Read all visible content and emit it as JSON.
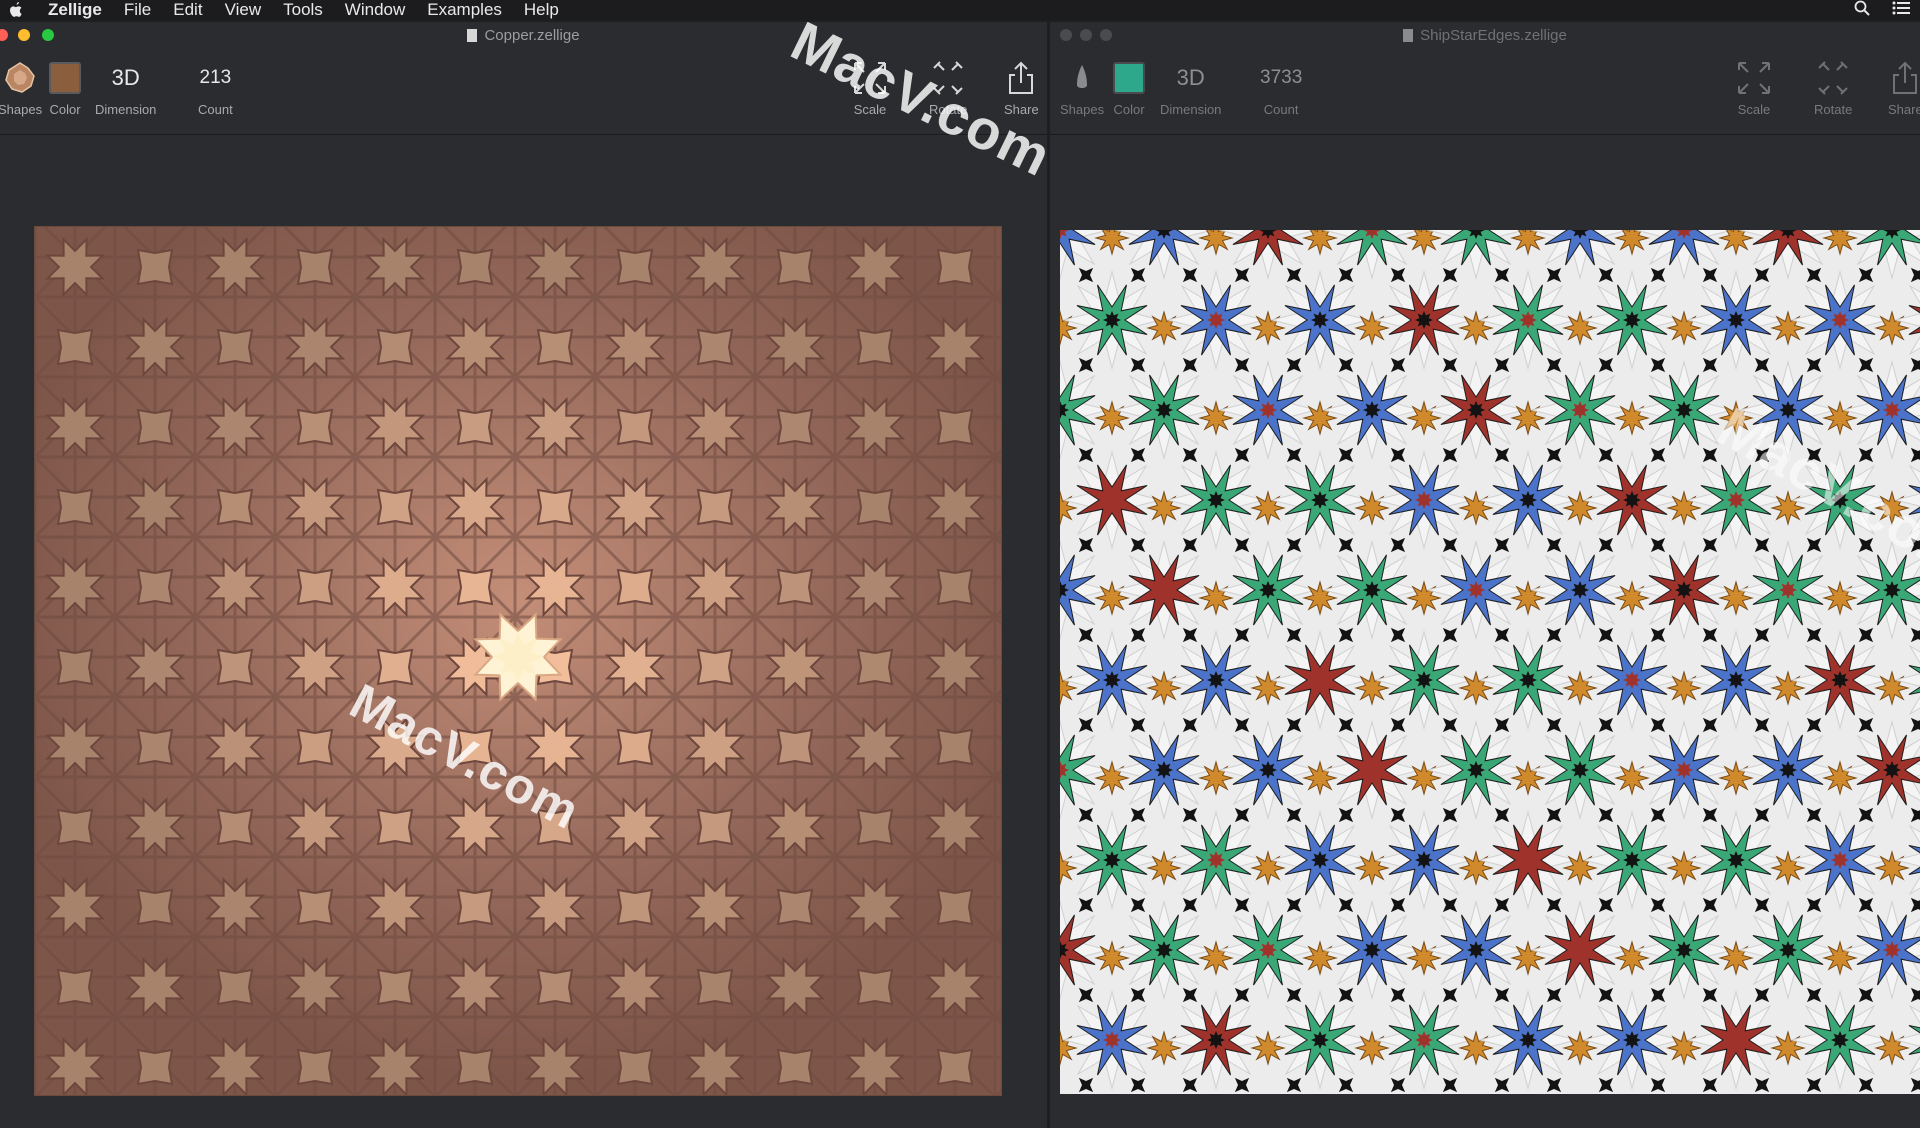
{
  "menubar": {
    "app_name": "Zellige",
    "items": [
      "File",
      "Edit",
      "View",
      "Tools",
      "Window",
      "Examples",
      "Help"
    ]
  },
  "left_window": {
    "title": "Copper.zellige",
    "toolbar": {
      "shapes_label": "Shapes",
      "color_label": "Color",
      "dimension_value": "3D",
      "dimension_label": "Dimension",
      "count_value": "213",
      "count_label": "Count",
      "scale_label": "Scale",
      "rotate_label": "Rotate",
      "share_label": "Share"
    },
    "swatch_color": "#8b5e3e"
  },
  "right_window": {
    "title": "ShipStarEdges.zellige",
    "toolbar": {
      "shapes_label": "Shapes",
      "color_label": "Color",
      "dimension_value": "3D",
      "dimension_label": "Dimension",
      "count_value": "3733",
      "count_label": "Count",
      "scale_label": "Scale",
      "rotate_label": "Rotate",
      "share_label": "Share"
    },
    "swatch_color": "#2ea88a"
  },
  "watermark": "MacV.com",
  "colors": {
    "copper_base": "#8a5f52",
    "copper_highlight": "#f7d9b6",
    "tile_blue": "#4b73c9",
    "tile_green": "#3aa876",
    "tile_red": "#a0322c",
    "tile_orange": "#d08a2c",
    "tile_black": "#131313",
    "tile_white": "#f1f1f1"
  }
}
